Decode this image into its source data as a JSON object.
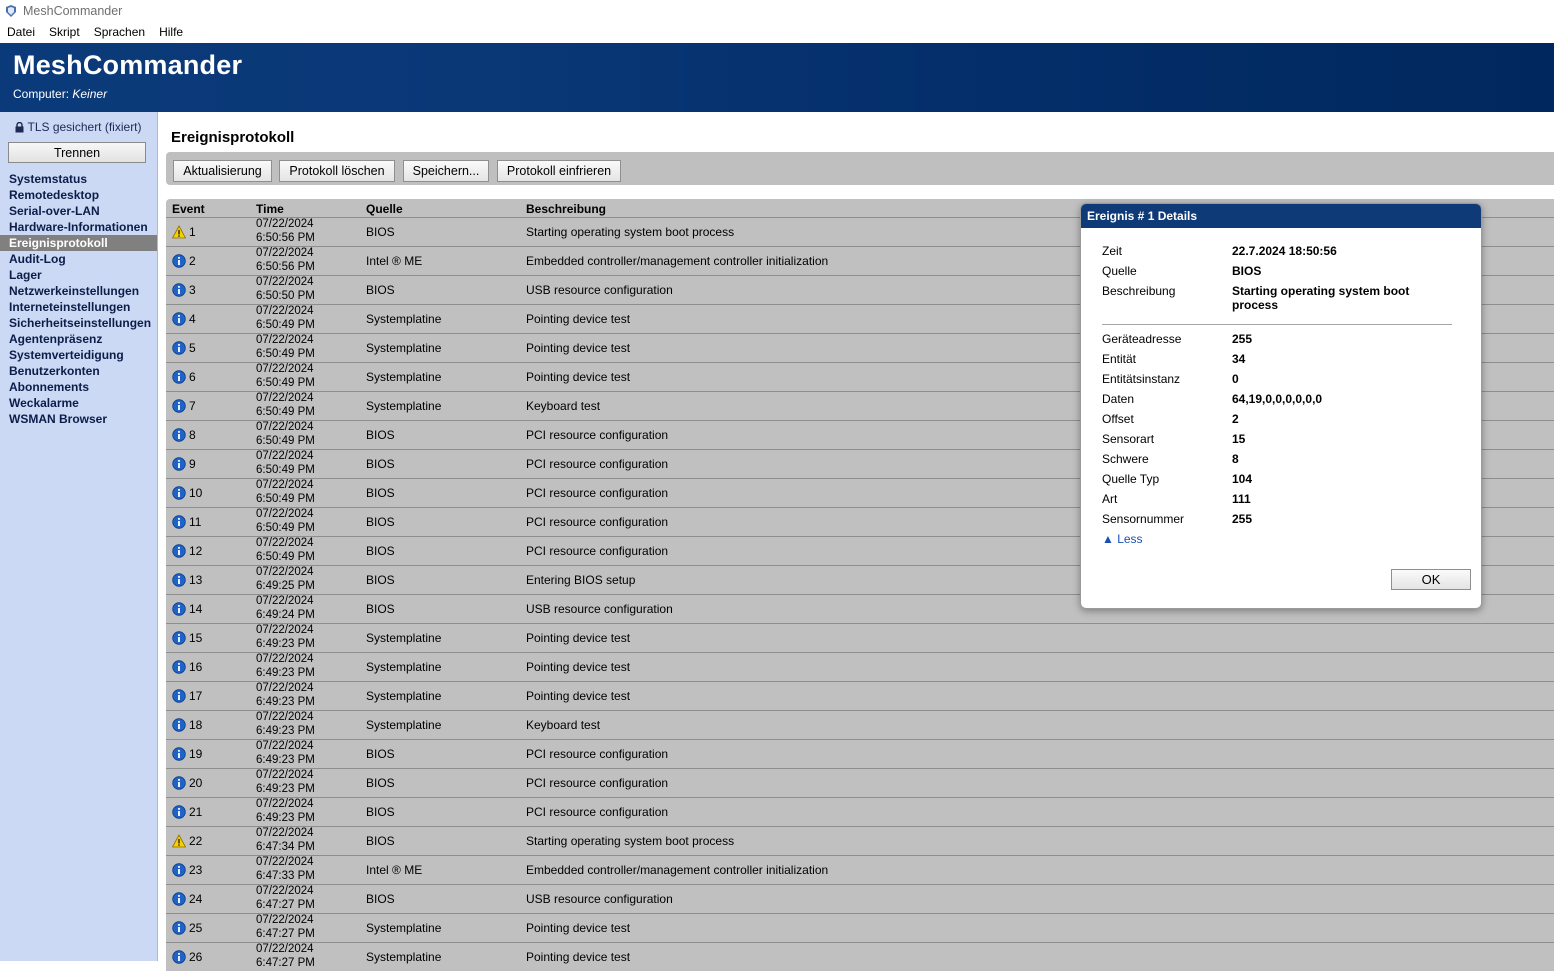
{
  "window": {
    "title": "MeshCommander"
  },
  "menu": [
    "Datei",
    "Skript",
    "Sprachen",
    "Hilfe"
  ],
  "header": {
    "title": "MeshCommander",
    "computer_label": "Computer:",
    "computer_value": "Keiner"
  },
  "sidebar": {
    "tls_status": "TLS gesichert (fixiert)",
    "disconnect_label": "Trennen",
    "active": "Ereignisprotokoll",
    "items": [
      "Systemstatus",
      "Remotedesktop",
      "Serial-over-LAN",
      "Hardware-Informationen",
      "Ereignisprotokoll",
      "Audit-Log",
      "Lager",
      "Netzwerkeinstellungen",
      "Interneteinstellungen",
      "Sicherheitseinstellungen",
      "Agentenpräsenz",
      "Systemverteidigung",
      "Benutzerkonten",
      "Abonnements",
      "Weckalarme",
      "WSMAN Browser"
    ]
  },
  "page": {
    "title": "Ereignisprotokoll"
  },
  "toolbar": {
    "refresh": "Aktualisierung",
    "clear": "Protokoll löschen",
    "save": "Speichern...",
    "freeze": "Protokoll einfrieren"
  },
  "table": {
    "headers": {
      "event": "Event",
      "time": "Time",
      "source": "Quelle",
      "description": "Beschreibung"
    },
    "rows": [
      {
        "type": "warning",
        "event": "1",
        "date": "07/22/2024",
        "time": "6:50:56 PM",
        "source": "BIOS",
        "description": "Starting operating system boot process"
      },
      {
        "type": "info",
        "event": "2",
        "date": "07/22/2024",
        "time": "6:50:56 PM",
        "source": "Intel ® ME",
        "description": "Embedded controller/management controller initialization"
      },
      {
        "type": "info",
        "event": "3",
        "date": "07/22/2024",
        "time": "6:50:50 PM",
        "source": "BIOS",
        "description": "USB resource configuration"
      },
      {
        "type": "info",
        "event": "4",
        "date": "07/22/2024",
        "time": "6:50:49 PM",
        "source": "Systemplatine",
        "description": "Pointing device test"
      },
      {
        "type": "info",
        "event": "5",
        "date": "07/22/2024",
        "time": "6:50:49 PM",
        "source": "Systemplatine",
        "description": "Pointing device test"
      },
      {
        "type": "info",
        "event": "6",
        "date": "07/22/2024",
        "time": "6:50:49 PM",
        "source": "Systemplatine",
        "description": "Pointing device test"
      },
      {
        "type": "info",
        "event": "7",
        "date": "07/22/2024",
        "time": "6:50:49 PM",
        "source": "Systemplatine",
        "description": "Keyboard test"
      },
      {
        "type": "info",
        "event": "8",
        "date": "07/22/2024",
        "time": "6:50:49 PM",
        "source": "BIOS",
        "description": "PCI resource configuration"
      },
      {
        "type": "info",
        "event": "9",
        "date": "07/22/2024",
        "time": "6:50:49 PM",
        "source": "BIOS",
        "description": "PCI resource configuration"
      },
      {
        "type": "info",
        "event": "10",
        "date": "07/22/2024",
        "time": "6:50:49 PM",
        "source": "BIOS",
        "description": "PCI resource configuration"
      },
      {
        "type": "info",
        "event": "11",
        "date": "07/22/2024",
        "time": "6:50:49 PM",
        "source": "BIOS",
        "description": "PCI resource configuration"
      },
      {
        "type": "info",
        "event": "12",
        "date": "07/22/2024",
        "time": "6:50:49 PM",
        "source": "BIOS",
        "description": "PCI resource configuration"
      },
      {
        "type": "info",
        "event": "13",
        "date": "07/22/2024",
        "time": "6:49:25 PM",
        "source": "BIOS",
        "description": "Entering BIOS setup"
      },
      {
        "type": "info",
        "event": "14",
        "date": "07/22/2024",
        "time": "6:49:24 PM",
        "source": "BIOS",
        "description": "USB resource configuration"
      },
      {
        "type": "info",
        "event": "15",
        "date": "07/22/2024",
        "time": "6:49:23 PM",
        "source": "Systemplatine",
        "description": "Pointing device test"
      },
      {
        "type": "info",
        "event": "16",
        "date": "07/22/2024",
        "time": "6:49:23 PM",
        "source": "Systemplatine",
        "description": "Pointing device test"
      },
      {
        "type": "info",
        "event": "17",
        "date": "07/22/2024",
        "time": "6:49:23 PM",
        "source": "Systemplatine",
        "description": "Pointing device test"
      },
      {
        "type": "info",
        "event": "18",
        "date": "07/22/2024",
        "time": "6:49:23 PM",
        "source": "Systemplatine",
        "description": "Keyboard test"
      },
      {
        "type": "info",
        "event": "19",
        "date": "07/22/2024",
        "time": "6:49:23 PM",
        "source": "BIOS",
        "description": "PCI resource configuration"
      },
      {
        "type": "info",
        "event": "20",
        "date": "07/22/2024",
        "time": "6:49:23 PM",
        "source": "BIOS",
        "description": "PCI resource configuration"
      },
      {
        "type": "info",
        "event": "21",
        "date": "07/22/2024",
        "time": "6:49:23 PM",
        "source": "BIOS",
        "description": "PCI resource configuration"
      },
      {
        "type": "warning",
        "event": "22",
        "date": "07/22/2024",
        "time": "6:47:34 PM",
        "source": "BIOS",
        "description": "Starting operating system boot process"
      },
      {
        "type": "info",
        "event": "23",
        "date": "07/22/2024",
        "time": "6:47:33 PM",
        "source": "Intel ® ME",
        "description": "Embedded controller/management controller initialization"
      },
      {
        "type": "info",
        "event": "24",
        "date": "07/22/2024",
        "time": "6:47:27 PM",
        "source": "BIOS",
        "description": "USB resource configuration"
      },
      {
        "type": "info",
        "event": "25",
        "date": "07/22/2024",
        "time": "6:47:27 PM",
        "source": "Systemplatine",
        "description": "Pointing device test"
      },
      {
        "type": "info",
        "event": "26",
        "date": "07/22/2024",
        "time": "6:47:27 PM",
        "source": "Systemplatine",
        "description": "Pointing device test"
      }
    ]
  },
  "dialog": {
    "title": "Ereignis # 1 Details",
    "fields": [
      {
        "label": "Zeit",
        "value": "22.7.2024 18:50:56"
      },
      {
        "label": "Quelle",
        "value": "BIOS"
      },
      {
        "label": "Beschreibung",
        "value": "Starting operating system boot process"
      }
    ],
    "details": [
      {
        "label": "Geräteadresse",
        "value": "255"
      },
      {
        "label": "Entität",
        "value": "34"
      },
      {
        "label": "Entitätsinstanz",
        "value": "0"
      },
      {
        "label": "Daten",
        "value": "64,19,0,0,0,0,0,0"
      },
      {
        "label": "Offset",
        "value": "2"
      },
      {
        "label": "Sensorart",
        "value": "15"
      },
      {
        "label": "Schwere",
        "value": "8"
      },
      {
        "label": "Quelle Typ",
        "value": "104"
      },
      {
        "label": "Art",
        "value": "111"
      },
      {
        "label": "Sensornummer",
        "value": "255"
      }
    ],
    "less_label": "▲ Less",
    "ok_label": "OK"
  },
  "colors": {
    "banner": "#0a3877",
    "sidebar": "#cbd9f4",
    "table": "#c0c0c0",
    "dialog_title": "#0e3b78",
    "link": "#1a4fb4"
  }
}
